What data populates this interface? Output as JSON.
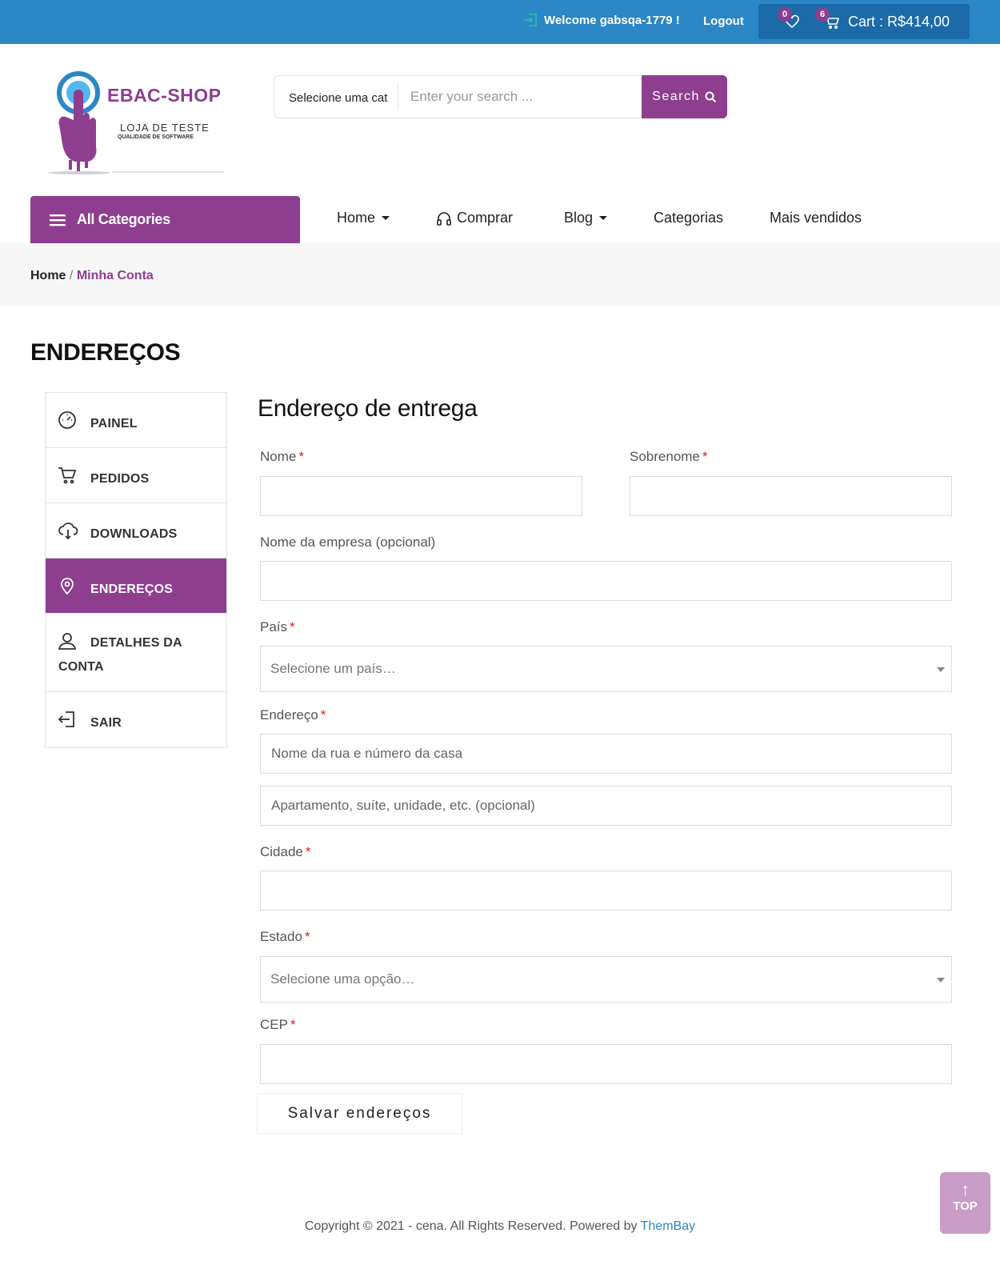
{
  "topbar": {
    "welcome": "Welcome gabsqa-1779 !",
    "logout": "Logout",
    "wishlist_count": "0",
    "cart_count": "6",
    "cart_label": "Cart : R$414,00"
  },
  "logo": {
    "title": "EBAC-SHOP",
    "subtitle": "LOJA DE TESTE",
    "tagline": "QUALIDADE DE SOFTWARE"
  },
  "search": {
    "category": "Selecione uma cat",
    "placeholder": "Enter your search ...",
    "button": "Search"
  },
  "nav": {
    "all_categories": "All Categories",
    "items": [
      "Home",
      "Comprar",
      "Blog",
      "Categorias",
      "Mais vendidos"
    ]
  },
  "breadcrumb": {
    "home": "Home",
    "separator": "/",
    "current": "Minha Conta"
  },
  "page_title": "ENDEREÇOS",
  "sidebar": {
    "items": [
      "PAINEL",
      "PEDIDOS",
      "DOWNLOADS",
      "ENDEREÇOS",
      "DETALHES DA CONTA",
      "SAIR"
    ]
  },
  "form": {
    "title": "Endereço de entrega",
    "required_mark": "*",
    "first_name_label": "Nome",
    "last_name_label": "Sobrenome",
    "company_label": "Nome da empresa (opcional)",
    "country_label": "País",
    "country_value": "Selecione um país…",
    "address_label": "Endereço",
    "address1_placeholder": "Nome da rua e número da casa",
    "address2_placeholder": "Apartamento, suíte, unidade, etc. (opcional)",
    "city_label": "Cidade",
    "state_label": "Estado",
    "state_value": "Selecione uma opção…",
    "cep_label": "CEP",
    "save_button": "Salvar endereços"
  },
  "footer": {
    "text": "Copyright © 2021 - cena. All Rights Reserved. Powered by ",
    "link": "ThemBay"
  },
  "top_button": "TOP",
  "colors": {
    "topbar": "#2b87c5",
    "accent": "#8e3e8f",
    "required": "#e01a1a"
  }
}
